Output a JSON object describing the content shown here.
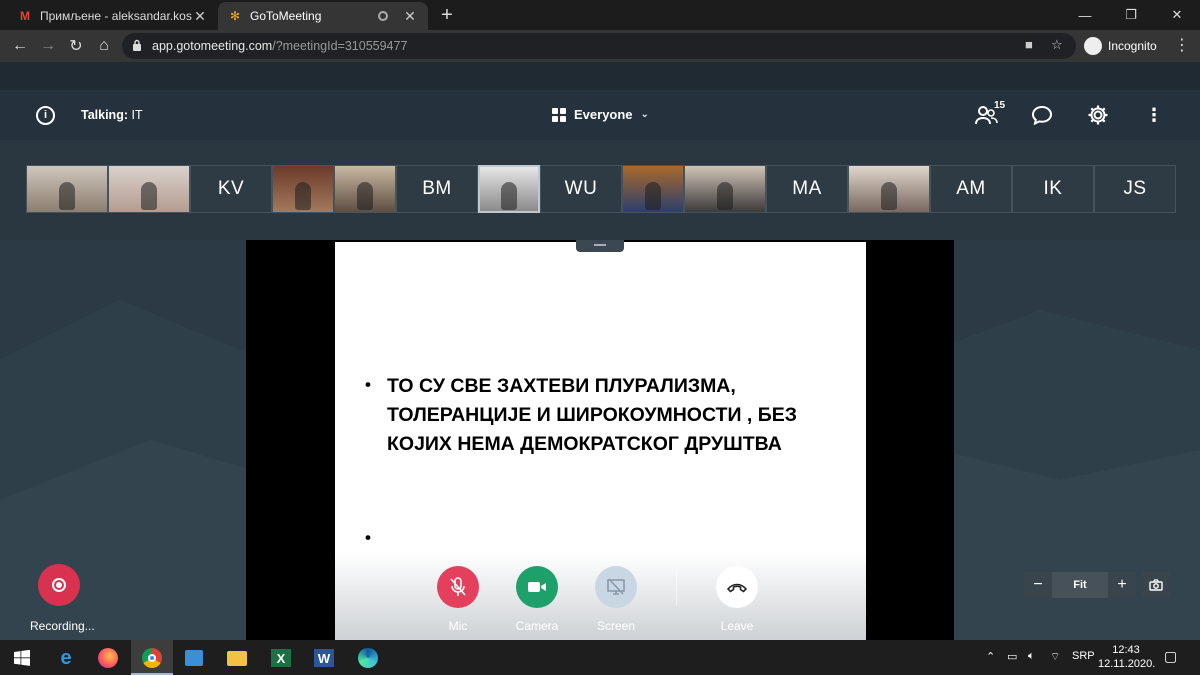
{
  "browser": {
    "tabs": [
      {
        "title": "Примљене - aleksandar.kostic@",
        "icon": "gmail-icon",
        "active": false
      },
      {
        "title": "GoToMeeting",
        "icon": "gotomeeting-icon",
        "active": true
      }
    ],
    "url_host": "app.gotomeeting.com",
    "url_path": "/?meetingId=310559477",
    "incognito_label": "Incognito"
  },
  "header": {
    "talking_label": "Talking:",
    "talking_value": "IT",
    "view_label": "Everyone",
    "participants_count": "15"
  },
  "thumbnails": [
    {
      "type": "video",
      "style": "v1"
    },
    {
      "type": "video",
      "style": "v2"
    },
    {
      "type": "initials",
      "label": "KV"
    },
    {
      "type": "video",
      "style": "v3"
    },
    {
      "type": "video",
      "style": "v4"
    },
    {
      "type": "initials",
      "label": "BM"
    },
    {
      "type": "video",
      "style": "v5",
      "selected": true
    },
    {
      "type": "initials",
      "label": "WU"
    },
    {
      "type": "video",
      "style": "v6"
    },
    {
      "type": "video",
      "style": "v7"
    },
    {
      "type": "initials",
      "label": "MA"
    },
    {
      "type": "video",
      "style": "v8"
    },
    {
      "type": "initials",
      "label": "AM"
    },
    {
      "type": "initials",
      "label": "IK"
    },
    {
      "type": "initials",
      "label": "JS"
    }
  ],
  "slide": {
    "bullets": [
      "ТО СУ СВЕ ЗАХТЕВИ ПЛУРАЛИЗМА, ТОЛЕРАНЦИЈЕ И ШИРОКОУМНОСТИ , БЕЗ КОЈИХ НЕМА ДЕМОКРАТСКОГ ДРУШТВА",
      ""
    ]
  },
  "controls": {
    "mic_label": "Mic",
    "camera_label": "Camera",
    "screen_label": "Screen",
    "leave_label": "Leave",
    "recording_label": "Recording...",
    "zoom_fit_label": "Fit",
    "colors": {
      "mic": "#e4405d",
      "camera": "#1ea06a",
      "screen": "#c9d6e3",
      "leave": "#ffffff",
      "recording": "#d8324e"
    }
  },
  "taskbar": {
    "language": "SRP",
    "time": "12:43",
    "date": "12.11.2020."
  }
}
